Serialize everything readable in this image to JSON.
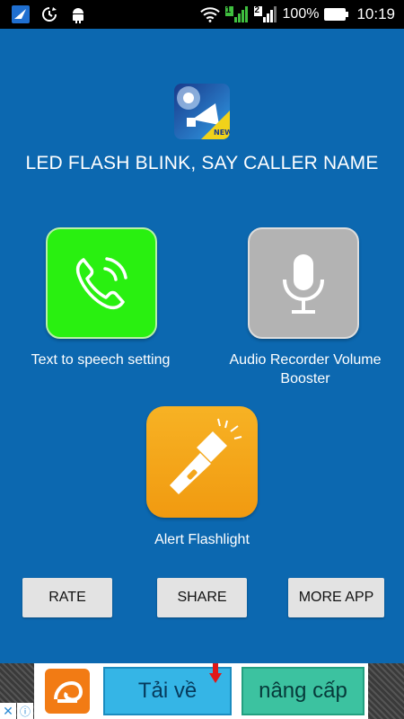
{
  "status_bar": {
    "left_icons": [
      "app-notification-icon",
      "sync-icon",
      "android-icon"
    ],
    "sim1": "1",
    "sim2": "2",
    "battery_percent": "100%",
    "time": "10:19"
  },
  "header": {
    "title": "LED FLASH BLINK, SAY CALLER NAME",
    "logo_icon": "flash-megaphone-logo-icon"
  },
  "features": [
    {
      "label": "Text to speech setting",
      "icon": "phone-call-icon",
      "color": "#29f010"
    },
    {
      "label": "Audio Recorder Volume Booster",
      "icon": "microphone-icon",
      "color": "#b3b3b3"
    },
    {
      "label": "Alert Flashlight",
      "icon": "flashlight-icon",
      "color": "#f4a61a"
    }
  ],
  "buttons": {
    "rate": "RATE",
    "share": "SHARE",
    "more_app": "MORE APP"
  },
  "ad": {
    "download_label": "Tải về",
    "upgrade_label": "nâng cấp"
  },
  "colors": {
    "background": "#0c68b0",
    "button_bg": "#e3e3e3"
  }
}
